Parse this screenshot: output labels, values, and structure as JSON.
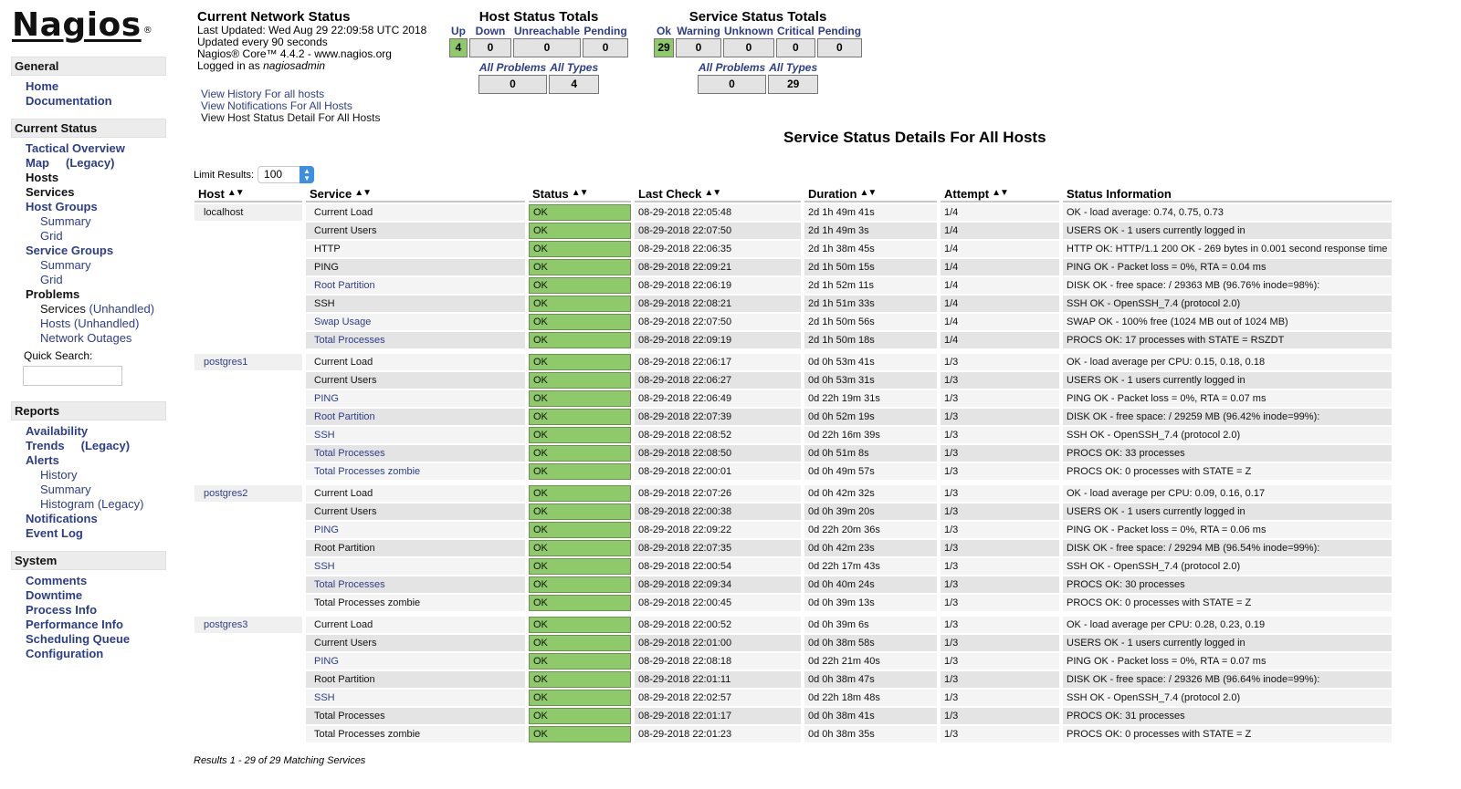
{
  "logo": {
    "text": "Nagios",
    "mark": "®"
  },
  "sidebar": {
    "general": {
      "header": "General",
      "items": [
        {
          "label": "Home"
        },
        {
          "label": "Documentation"
        }
      ]
    },
    "current_status": {
      "header": "Current Status",
      "items": [
        {
          "label": "Tactical Overview",
          "level": 1,
          "link": true
        },
        {
          "label": "Map",
          "suffix": "(Legacy)",
          "level": 1,
          "link": true
        },
        {
          "label": "Hosts",
          "level": 1,
          "link": false
        },
        {
          "label": "Services",
          "level": 1,
          "link": false
        },
        {
          "label": "Host Groups",
          "level": 1,
          "link": true
        },
        {
          "label": "Summary",
          "level": 2,
          "link": true
        },
        {
          "label": "Grid",
          "level": 2,
          "link": true
        },
        {
          "label": "Service Groups",
          "level": 1,
          "link": true
        },
        {
          "label": "Summary",
          "level": 2,
          "link": true
        },
        {
          "label": "Grid",
          "level": 2,
          "link": true
        },
        {
          "label": "Problems",
          "level": 1,
          "link": false
        },
        {
          "label": "Services",
          "suffix": "(Unhandled)",
          "level": 2,
          "link": false
        },
        {
          "label": "Hosts",
          "suffix": "(Unhandled)",
          "level": 2,
          "link": true
        },
        {
          "label": "Network Outages",
          "level": 2,
          "link": true
        }
      ],
      "quick_search_label": "Quick Search:",
      "quick_search_value": ""
    },
    "reports": {
      "header": "Reports",
      "items": [
        {
          "label": "Availability",
          "level": 1
        },
        {
          "label": "Trends",
          "suffix": "(Legacy)",
          "level": 1
        },
        {
          "label": "Alerts",
          "level": 1
        },
        {
          "label": "History",
          "level": 2
        },
        {
          "label": "Summary",
          "level": 2
        },
        {
          "label": "Histogram (Legacy)",
          "level": 2
        },
        {
          "label": "Notifications",
          "level": 1
        },
        {
          "label": "Event Log",
          "level": 1
        }
      ]
    },
    "system": {
      "header": "System",
      "items": [
        {
          "label": "Comments"
        },
        {
          "label": "Downtime"
        },
        {
          "label": "Process Info"
        },
        {
          "label": "Performance Info"
        },
        {
          "label": "Scheduling Queue"
        },
        {
          "label": "Configuration"
        }
      ]
    }
  },
  "network_status": {
    "title": "Current Network Status",
    "last_updated": "Last Updated: Wed Aug 29 22:09:58 UTC 2018",
    "update_interval": "Updated every 90 seconds",
    "version": "Nagios® Core™ 4.4.2 - www.nagios.org",
    "logged_in_prefix": "Logged in as ",
    "logged_in_user": "nagiosadmin",
    "links": {
      "history": "View History For all hosts",
      "notifications": "View Notifications For All Hosts",
      "host_detail": "View Host Status Detail For All Hosts"
    }
  },
  "host_totals": {
    "title": "Host Status Totals",
    "headers": [
      "Up",
      "Down",
      "Unreachable",
      "Pending"
    ],
    "values": [
      "4",
      "0",
      "0",
      "0"
    ],
    "sub_headers": [
      "All Problems",
      "All Types"
    ],
    "sub_values": [
      "0",
      "4"
    ]
  },
  "service_totals": {
    "title": "Service Status Totals",
    "headers": [
      "Ok",
      "Warning",
      "Unknown",
      "Critical",
      "Pending"
    ],
    "values": [
      "29",
      "0",
      "0",
      "0",
      "0"
    ],
    "sub_headers": [
      "All Problems",
      "All Types"
    ],
    "sub_values": [
      "0",
      "29"
    ]
  },
  "colors": {
    "ok": "#8ec96a",
    "link": "#2c3e87",
    "header_bg": "#ececec"
  },
  "page_title": "Service Status Details For All Hosts",
  "limit": {
    "label": "Limit Results:",
    "value": "100"
  },
  "table": {
    "columns": [
      "Host",
      "Service",
      "Status",
      "Last Check",
      "Duration",
      "Attempt",
      "Status Information"
    ],
    "sort_icon": "▲▼",
    "groups": [
      {
        "host": "localhost",
        "host_link": false,
        "rows": [
          {
            "service": "Current Load",
            "link": false,
            "status": "OK",
            "last_check": "08-29-2018 22:05:48",
            "duration": "2d 1h 49m 41s",
            "attempt": "1/4",
            "info": "OK - load average: 0.74, 0.75, 0.73"
          },
          {
            "service": "Current Users",
            "link": false,
            "status": "OK",
            "last_check": "08-29-2018 22:07:50",
            "duration": "2d 1h 49m 3s",
            "attempt": "1/4",
            "info": "USERS OK - 1 users currently logged in"
          },
          {
            "service": "HTTP",
            "link": false,
            "status": "OK",
            "last_check": "08-29-2018 22:06:35",
            "duration": "2d 1h 38m 45s",
            "attempt": "1/4",
            "info": "HTTP OK: HTTP/1.1 200 OK - 269 bytes in 0.001 second response time"
          },
          {
            "service": "PING",
            "link": false,
            "status": "OK",
            "last_check": "08-29-2018 22:09:21",
            "duration": "2d 1h 50m 15s",
            "attempt": "1/4",
            "info": "PING OK - Packet loss = 0%, RTA = 0.04 ms"
          },
          {
            "service": "Root Partition",
            "link": true,
            "status": "OK",
            "last_check": "08-29-2018 22:06:19",
            "duration": "2d 1h 52m 11s",
            "attempt": "1/4",
            "info": "DISK OK - free space: / 29363 MB (96.76% inode=98%):"
          },
          {
            "service": "SSH",
            "link": false,
            "status": "OK",
            "last_check": "08-29-2018 22:08:21",
            "duration": "2d 1h 51m 33s",
            "attempt": "1/4",
            "info": "SSH OK - OpenSSH_7.4 (protocol 2.0)"
          },
          {
            "service": "Swap Usage",
            "link": true,
            "status": "OK",
            "last_check": "08-29-2018 22:07:50",
            "duration": "2d 1h 50m 56s",
            "attempt": "1/4",
            "info": "SWAP OK - 100% free (1024 MB out of 1024 MB)"
          },
          {
            "service": "Total Processes",
            "link": true,
            "status": "OK",
            "last_check": "08-29-2018 22:09:19",
            "duration": "2d 1h 50m 18s",
            "attempt": "1/4",
            "info": "PROCS OK: 17 processes with STATE = RSZDT"
          }
        ]
      },
      {
        "host": "postgres1",
        "host_link": true,
        "rows": [
          {
            "service": "Current Load",
            "link": false,
            "status": "OK",
            "last_check": "08-29-2018 22:06:17",
            "duration": "0d 0h 53m 41s",
            "attempt": "1/3",
            "info": "OK - load average per CPU: 0.15, 0.18, 0.18"
          },
          {
            "service": "Current Users",
            "link": false,
            "status": "OK",
            "last_check": "08-29-2018 22:06:27",
            "duration": "0d 0h 53m 31s",
            "attempt": "1/3",
            "info": "USERS OK - 1 users currently logged in"
          },
          {
            "service": "PING",
            "link": true,
            "status": "OK",
            "last_check": "08-29-2018 22:06:49",
            "duration": "0d 22h 19m 31s",
            "attempt": "1/3",
            "info": "PING OK - Packet loss = 0%, RTA = 0.07 ms"
          },
          {
            "service": "Root Partition",
            "link": true,
            "status": "OK",
            "last_check": "08-29-2018 22:07:39",
            "duration": "0d 0h 52m 19s",
            "attempt": "1/3",
            "info": "DISK OK - free space: / 29259 MB (96.42% inode=99%):"
          },
          {
            "service": "SSH",
            "link": true,
            "status": "OK",
            "last_check": "08-29-2018 22:08:52",
            "duration": "0d 22h 16m 39s",
            "attempt": "1/3",
            "info": "SSH OK - OpenSSH_7.4 (protocol 2.0)"
          },
          {
            "service": "Total Processes",
            "link": true,
            "status": "OK",
            "last_check": "08-29-2018 22:08:50",
            "duration": "0d 0h 51m 8s",
            "attempt": "1/3",
            "info": "PROCS OK: 33 processes"
          },
          {
            "service": "Total Processes zombie",
            "link": true,
            "status": "OK",
            "last_check": "08-29-2018 22:00:01",
            "duration": "0d 0h 49m 57s",
            "attempt": "1/3",
            "info": "PROCS OK: 0 processes with STATE = Z"
          }
        ]
      },
      {
        "host": "postgres2",
        "host_link": true,
        "rows": [
          {
            "service": "Current Load",
            "link": false,
            "status": "OK",
            "last_check": "08-29-2018 22:07:26",
            "duration": "0d 0h 42m 32s",
            "attempt": "1/3",
            "info": "OK - load average per CPU: 0.09, 0.16, 0.17"
          },
          {
            "service": "Current Users",
            "link": false,
            "status": "OK",
            "last_check": "08-29-2018 22:00:38",
            "duration": "0d 0h 39m 20s",
            "attempt": "1/3",
            "info": "USERS OK - 1 users currently logged in"
          },
          {
            "service": "PING",
            "link": true,
            "status": "OK",
            "last_check": "08-29-2018 22:09:22",
            "duration": "0d 22h 20m 36s",
            "attempt": "1/3",
            "info": "PING OK - Packet loss = 0%, RTA = 0.06 ms"
          },
          {
            "service": "Root Partition",
            "link": false,
            "status": "OK",
            "last_check": "08-29-2018 22:07:35",
            "duration": "0d 0h 42m 23s",
            "attempt": "1/3",
            "info": "DISK OK - free space: / 29294 MB (96.54% inode=99%):"
          },
          {
            "service": "SSH",
            "link": true,
            "status": "OK",
            "last_check": "08-29-2018 22:00:54",
            "duration": "0d 22h 17m 43s",
            "attempt": "1/3",
            "info": "SSH OK - OpenSSH_7.4 (protocol 2.0)"
          },
          {
            "service": "Total Processes",
            "link": true,
            "status": "OK",
            "last_check": "08-29-2018 22:09:34",
            "duration": "0d 0h 40m 24s",
            "attempt": "1/3",
            "info": "PROCS OK: 30 processes"
          },
          {
            "service": "Total Processes zombie",
            "link": false,
            "status": "OK",
            "last_check": "08-29-2018 22:00:45",
            "duration": "0d 0h 39m 13s",
            "attempt": "1/3",
            "info": "PROCS OK: 0 processes with STATE = Z"
          }
        ]
      },
      {
        "host": "postgres3",
        "host_link": true,
        "rows": [
          {
            "service": "Current Load",
            "link": false,
            "status": "OK",
            "last_check": "08-29-2018 22:00:52",
            "duration": "0d 0h 39m 6s",
            "attempt": "1/3",
            "info": "OK - load average per CPU: 0.28, 0.23, 0.19"
          },
          {
            "service": "Current Users",
            "link": false,
            "status": "OK",
            "last_check": "08-29-2018 22:01:00",
            "duration": "0d 0h 38m 58s",
            "attempt": "1/3",
            "info": "USERS OK - 1 users currently logged in"
          },
          {
            "service": "PING",
            "link": true,
            "status": "OK",
            "last_check": "08-29-2018 22:08:18",
            "duration": "0d 22h 21m 40s",
            "attempt": "1/3",
            "info": "PING OK - Packet loss = 0%, RTA = 0.07 ms"
          },
          {
            "service": "Root Partition",
            "link": false,
            "status": "OK",
            "last_check": "08-29-2018 22:01:11",
            "duration": "0d 0h 38m 47s",
            "attempt": "1/3",
            "info": "DISK OK - free space: / 29326 MB (96.64% inode=99%):"
          },
          {
            "service": "SSH",
            "link": true,
            "status": "OK",
            "last_check": "08-29-2018 22:02:57",
            "duration": "0d 22h 18m 48s",
            "attempt": "1/3",
            "info": "SSH OK - OpenSSH_7.4 (protocol 2.0)"
          },
          {
            "service": "Total Processes",
            "link": false,
            "status": "OK",
            "last_check": "08-29-2018 22:01:17",
            "duration": "0d 0h 38m 41s",
            "attempt": "1/3",
            "info": "PROCS OK: 31 processes"
          },
          {
            "service": "Total Processes zombie",
            "link": false,
            "status": "OK",
            "last_check": "08-29-2018 22:01:23",
            "duration": "0d 0h 38m 35s",
            "attempt": "1/3",
            "info": "PROCS OK: 0 processes with STATE = Z"
          }
        ]
      }
    ]
  },
  "results_text": "Results 1 - 29 of 29 Matching Services"
}
